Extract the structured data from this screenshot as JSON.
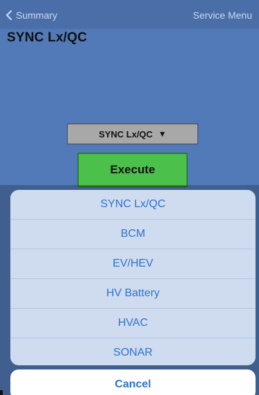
{
  "colors": {
    "background": "#527ab8",
    "navbar": "#4a6fa8",
    "execute_button": "#4bc04a",
    "sheet_background": "#cfdcef",
    "sheet_text": "#2f72cf",
    "select_background": "#a8a8a8"
  },
  "navbar": {
    "back_icon": "chevron-left-icon",
    "back_label": "Summary",
    "right_label": "Service Menu"
  },
  "page": {
    "title": "SYNC Lx/QC"
  },
  "module_select": {
    "value": "SYNC Lx/QC",
    "arrow": "▼",
    "icon": "triangle-down-icon"
  },
  "execute": {
    "label": "Execute"
  },
  "action_sheet": {
    "options": [
      {
        "label": "SYNC Lx/QC"
      },
      {
        "label": "BCM"
      },
      {
        "label": "EV/HEV"
      },
      {
        "label": "HV Battery"
      },
      {
        "label": "HVAC"
      },
      {
        "label": "SONAR"
      }
    ],
    "cancel_label": "Cancel"
  }
}
